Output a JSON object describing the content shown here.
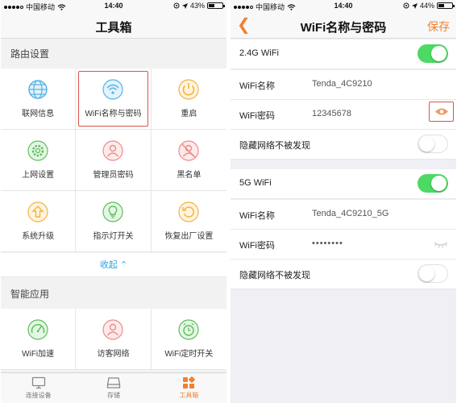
{
  "colors": {
    "accent": "#f08030",
    "toggle_on": "#4cd964",
    "highlight": "#d9534f",
    "link": "#2aa1e0",
    "icon": "#55b4e8"
  },
  "left": {
    "status": {
      "carrier": "中国移动",
      "time": "14:40",
      "battery": "43%",
      "battery_level": 0.43
    },
    "title": "工具箱",
    "sections": [
      {
        "title": "路由设置",
        "items": [
          {
            "label": "联网信息",
            "icon": "globe-icon"
          },
          {
            "label": "WiFi名称与密码",
            "icon": "wifi-icon"
          },
          {
            "label": "重启",
            "icon": "power-icon"
          },
          {
            "label": "上网设置",
            "icon": "gear-icon"
          },
          {
            "label": "管理员密码",
            "icon": "user-icon"
          },
          {
            "label": "黑名单",
            "icon": "blocked-user-icon"
          },
          {
            "label": "系统升级",
            "icon": "upgrade-icon"
          },
          {
            "label": "指示灯开关",
            "icon": "lightbulb-icon"
          },
          {
            "label": "恢复出厂设置",
            "icon": "reset-icon"
          }
        ],
        "collapse_label": "收起"
      },
      {
        "title": "智能应用",
        "items": [
          {
            "label": "WiFi加速",
            "icon": "speedometer-icon"
          },
          {
            "label": "访客网络",
            "icon": "guest-icon"
          },
          {
            "label": "WiFi定时开关",
            "icon": "alarm-clock-icon"
          }
        ]
      }
    ],
    "tabs": [
      {
        "label": "连接设备",
        "icon": "monitor-icon",
        "active": false
      },
      {
        "label": "存储",
        "icon": "storage-icon",
        "active": false
      },
      {
        "label": "工具箱",
        "icon": "toolbox-icon",
        "active": true
      }
    ]
  },
  "right": {
    "status": {
      "carrier": "中国移动",
      "time": "14:40",
      "battery": "44%",
      "battery_level": 0.44
    },
    "title": "WiFi名称与密码",
    "save_label": "保存",
    "band24": {
      "label": "2.4G WiFi",
      "enabled": true,
      "name_label": "WiFi名称",
      "name_value": "Tenda_4C9210",
      "password_label": "WiFi密码",
      "password_value": "12345678",
      "hide_label": "隐藏网络不被发现",
      "hidden": false
    },
    "band5": {
      "label": "5G WiFi",
      "enabled": true,
      "name_label": "WiFi名称",
      "name_value": "Tenda_4C9210_5G",
      "password_label": "WiFi密码",
      "password_value": "••••••••",
      "hide_label": "隐藏网络不被发现",
      "hidden": false
    }
  }
}
